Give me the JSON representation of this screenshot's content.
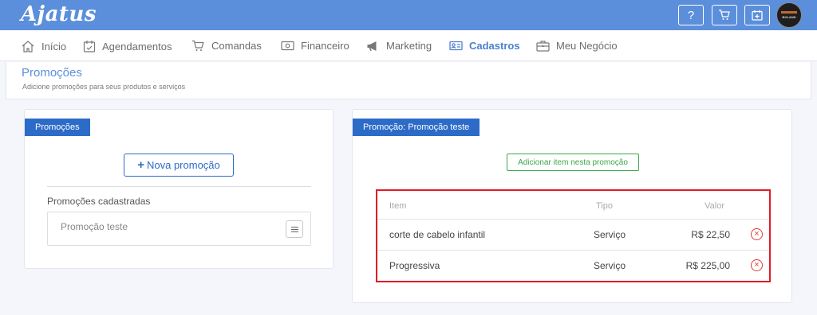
{
  "app": {
    "logo": "Ajatus"
  },
  "topbar": {
    "help_label": "?",
    "avatar_text": "BOLAND"
  },
  "nav": {
    "items": [
      {
        "label": "Início",
        "icon": "home-icon"
      },
      {
        "label": "Agendamentos",
        "icon": "calendar-check-icon"
      },
      {
        "label": "Comandas",
        "icon": "cart-icon"
      },
      {
        "label": "Financeiro",
        "icon": "money-icon"
      },
      {
        "label": "Marketing",
        "icon": "megaphone-icon"
      },
      {
        "label": "Cadastros",
        "icon": "id-card-icon",
        "active": true
      },
      {
        "label": "Meu Negócio",
        "icon": "briefcase-icon"
      }
    ]
  },
  "page": {
    "title": "Promoções",
    "subtitle": "Adicione promoções para seus produtos e serviços"
  },
  "left_card": {
    "tab": "Promoções",
    "new_button": "Nova promoção",
    "list_title": "Promoções cadastradas",
    "items": [
      {
        "label": "Promoção teste"
      }
    ]
  },
  "right_card": {
    "tab": "Promoção: Promoção teste",
    "add_button": "Adicionar item nesta promoção",
    "table": {
      "headers": {
        "item": "Item",
        "tipo": "Tipo",
        "valor": "Valor"
      },
      "rows": [
        {
          "item": "corte de cabelo infantil",
          "tipo": "Serviço",
          "valor": "R$ 22,50"
        },
        {
          "item": "Progressiva",
          "tipo": "Serviço",
          "valor": "R$ 225,00"
        }
      ]
    }
  },
  "colors": {
    "topbar": "#5b8fdc",
    "tab": "#2d6bc8",
    "success": "#3aa84a",
    "highlight": "#e01b24"
  }
}
